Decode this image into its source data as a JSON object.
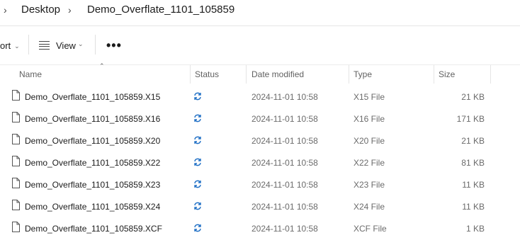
{
  "breadcrumb": {
    "items": [
      "Desktop",
      "Demo_Overflate_1101_105859"
    ]
  },
  "toolbar": {
    "sort_label": "ort",
    "view_label": "View",
    "more_label": "•••"
  },
  "columns": {
    "name": "Name",
    "status": "Status",
    "date_modified": "Date modified",
    "type": "Type",
    "size": "Size"
  },
  "files": [
    {
      "name": "Demo_Overflate_1101_105859.X15",
      "status": "sync",
      "date": "2024-11-01 10:58",
      "type": "X15 File",
      "size": "21 KB"
    },
    {
      "name": "Demo_Overflate_1101_105859.X16",
      "status": "sync",
      "date": "2024-11-01 10:58",
      "type": "X16 File",
      "size": "171 KB"
    },
    {
      "name": "Demo_Overflate_1101_105859.X20",
      "status": "sync",
      "date": "2024-11-01 10:58",
      "type": "X20 File",
      "size": "21 KB"
    },
    {
      "name": "Demo_Overflate_1101_105859.X22",
      "status": "sync",
      "date": "2024-11-01 10:58",
      "type": "X22 File",
      "size": "81 KB"
    },
    {
      "name": "Demo_Overflate_1101_105859.X23",
      "status": "sync",
      "date": "2024-11-01 10:58",
      "type": "X23 File",
      "size": "11 KB"
    },
    {
      "name": "Demo_Overflate_1101_105859.X24",
      "status": "sync",
      "date": "2024-11-01 10:58",
      "type": "X24 File",
      "size": "11 KB"
    },
    {
      "name": "Demo_Overflate_1101_105859.XCF",
      "status": "sync",
      "date": "2024-11-01 10:58",
      "type": "XCF File",
      "size": "1 KB"
    }
  ],
  "colors": {
    "sync_icon": "#1f6fc5",
    "secondary_text": "#6b6b6b"
  }
}
